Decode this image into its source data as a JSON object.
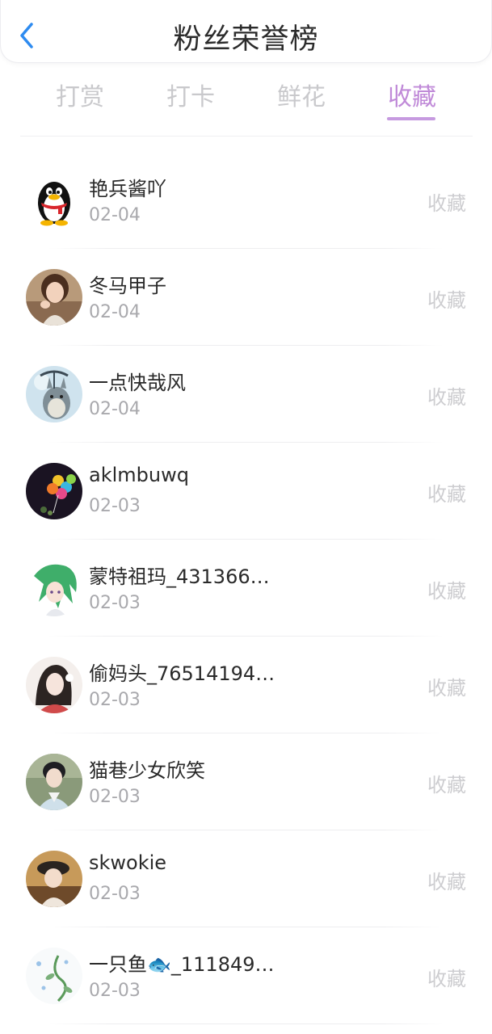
{
  "header": {
    "title": "粉丝荣誉榜"
  },
  "tabs": [
    {
      "label": "打赏"
    },
    {
      "label": "打卡"
    },
    {
      "label": "鲜花"
    },
    {
      "label": "收藏"
    }
  ],
  "active_tab": "收藏",
  "colors": {
    "accent": "#c08ad8",
    "back_icon": "#2e8bf0",
    "inactive_text": "#c9c9cc"
  },
  "fans": [
    {
      "name": "艳兵酱吖",
      "date": "02-04",
      "action": "收藏",
      "avatar": "qq-penguin"
    },
    {
      "name": "冬马甲子",
      "date": "02-04",
      "action": "收藏",
      "avatar": "photo-woman"
    },
    {
      "name": "一点快哉风",
      "date": "02-04",
      "action": "收藏",
      "avatar": "totoro"
    },
    {
      "name": "aklmbuwq",
      "date": "02-03",
      "action": "收藏",
      "avatar": "balloons"
    },
    {
      "name": "蒙特祖玛_431366…",
      "date": "02-03",
      "action": "收藏",
      "avatar": "anime-green-hair"
    },
    {
      "name": "偷妈头_76514194…",
      "date": "02-03",
      "action": "收藏",
      "avatar": "anime-girl-dark"
    },
    {
      "name": "猫巷少女欣笑",
      "date": "02-03",
      "action": "收藏",
      "avatar": "costume-man"
    },
    {
      "name": "skwokie",
      "date": "02-03",
      "action": "收藏",
      "avatar": "photo-girl-hat"
    },
    {
      "name": "一只鱼🐟_111849…",
      "date": "02-03",
      "action": "收藏",
      "avatar": "fish-plant"
    }
  ]
}
